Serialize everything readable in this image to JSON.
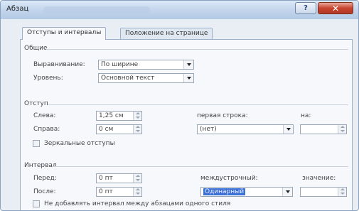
{
  "window": {
    "title": "Абзац",
    "help_glyph": "?",
    "close_glyph": "✕"
  },
  "tabs": [
    {
      "label": "Отступы и интервалы",
      "active": true
    },
    {
      "label": "Положение на странице",
      "active": false
    }
  ],
  "general": {
    "heading": "Общие",
    "alignment_label": "Выравнивание:",
    "alignment_value": "По ширине",
    "level_label": "Уровень:",
    "level_value": "Основной текст"
  },
  "indent": {
    "heading": "Отступ",
    "left_label": "Слева:",
    "left_value": "1,25 см",
    "right_label": "Справа:",
    "right_value": "0 см",
    "first_line_label": "первая строка:",
    "first_line_value": "(нет)",
    "by_label": "на:",
    "by_value": "",
    "mirror_label": "Зеркальные отступы",
    "mirror_checked": false
  },
  "spacing": {
    "heading": "Интервал",
    "before_label": "Перед:",
    "before_value": "0 пт",
    "after_label": "После:",
    "after_value": "0 пт",
    "line_spacing_label": "междустрочный:",
    "line_spacing_value": "Одинарный",
    "value_label": "значение:",
    "value_value": "",
    "no_space_label": "Не добавлять интервал между абзацами одного стиля",
    "no_space_checked": false
  },
  "colors": {
    "titlebar": "#c3d6ec",
    "close_button": "#c8442f",
    "selection": "#3a6fd6"
  }
}
